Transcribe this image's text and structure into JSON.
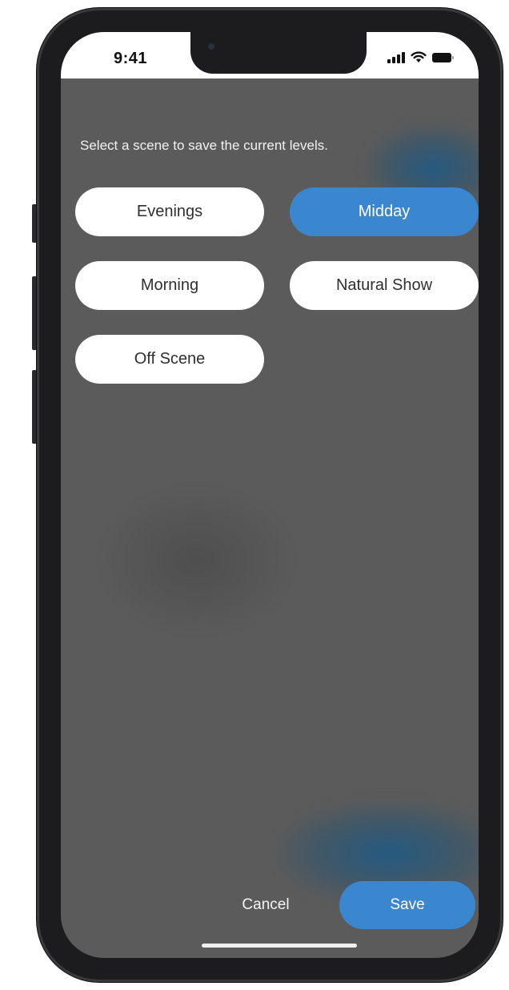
{
  "status_bar": {
    "time": "9:41",
    "icons": [
      "cellular-signal-icon",
      "wifi-icon",
      "battery-icon"
    ]
  },
  "instruction": "Select a scene to save the current levels.",
  "scenes": [
    {
      "label": "Evenings",
      "selected": false
    },
    {
      "label": "Midday",
      "selected": true
    },
    {
      "label": "Morning",
      "selected": false
    },
    {
      "label": "Natural Show",
      "selected": false
    },
    {
      "label": "Off Scene",
      "selected": false
    }
  ],
  "actions": {
    "cancel_label": "Cancel",
    "save_label": "Save"
  },
  "colors": {
    "accent": "#3a87cf",
    "background": "#5b5b5b",
    "button": "#ffffff"
  }
}
